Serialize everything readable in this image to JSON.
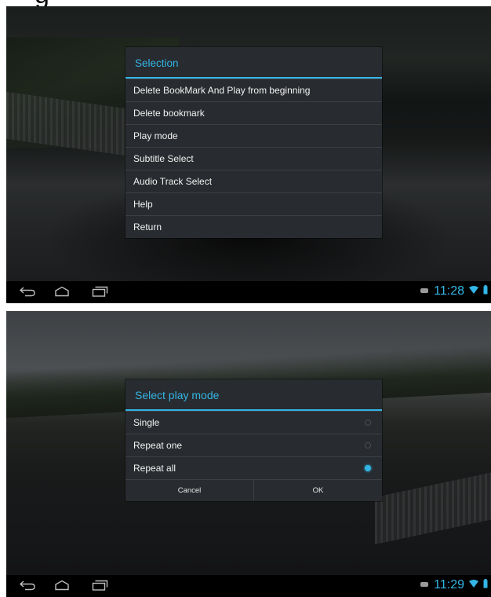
{
  "caption_fragment": "g",
  "screen_top": {
    "dialog": {
      "title": "Selection",
      "items": [
        "Delete BookMark And Play from beginning",
        "Delete bookmark",
        "Play mode",
        "Subtitle Select",
        "Audio Track Select",
        "Help",
        "Return"
      ]
    },
    "status_bar": {
      "time": "11:28"
    }
  },
  "screen_bottom": {
    "dialog": {
      "title": "Select play mode",
      "options": [
        {
          "label": "Single",
          "selected": false
        },
        {
          "label": "Repeat one",
          "selected": false
        },
        {
          "label": "Repeat all",
          "selected": true
        }
      ],
      "cancel_label": "Cancel",
      "ok_label": "OK"
    },
    "status_bar": {
      "time": "11:29"
    }
  },
  "colors": {
    "accent": "#33b5e5",
    "dialog_bg": "#282b2f",
    "navbar_bg": "#000000"
  },
  "icons": [
    "back-icon",
    "home-icon",
    "recent-apps-icon",
    "notification-icon",
    "wifi-icon",
    "battery-icon"
  ]
}
